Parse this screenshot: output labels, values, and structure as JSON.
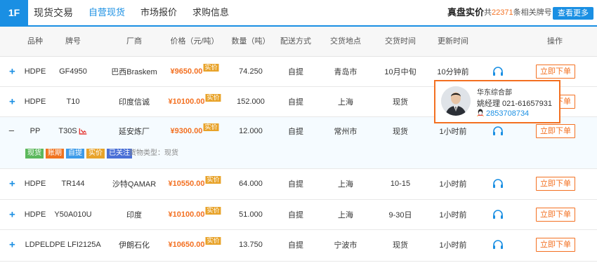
{
  "topbar": {
    "floor": "1F",
    "section": "现货交易",
    "tabs": [
      "自营现货",
      "市场报价",
      "求购信息"
    ],
    "realtime_title": "真盘实价",
    "count_prefix": "共",
    "count": "22371",
    "count_suffix": "条相关牌号",
    "more_label": "查看更多"
  },
  "columns": [
    "品种",
    "牌号",
    "厂商",
    "价格（元/吨）",
    "数量（吨）",
    "配送方式",
    "交货地点",
    "交货时间",
    "更新时间",
    "操作"
  ],
  "rows": [
    {
      "type": "HDPE",
      "grade": "GF4950",
      "maker": "巴西Braskem",
      "price": "¥9650.00",
      "qty": "74.250",
      "delivery": "自提",
      "place": "青岛市",
      "time": "10月中旬",
      "updated": "10分钟前",
      "action": "立即下单"
    },
    {
      "type": "HDPE",
      "grade": "T10",
      "maker": "印度信诚",
      "price": "¥10100.00",
      "qty": "152.000",
      "delivery": "自提",
      "place": "上海",
      "time": "现货",
      "updated": "",
      "action": "立即下单"
    },
    {
      "type": "PP",
      "grade": "T30S",
      "maker": "延安炼厂",
      "price": "¥9300.00",
      "qty": "12.000",
      "delivery": "自提",
      "place": "常州市",
      "time": "现货",
      "updated": "1小时前",
      "action": "立即下单"
    },
    {
      "type": "HDPE",
      "grade": "TR144",
      "maker": "沙特QAMAR",
      "price": "¥10550.00",
      "qty": "64.000",
      "delivery": "自提",
      "place": "上海",
      "time": "10-15",
      "updated": "1小时前",
      "action": "立即下单"
    },
    {
      "type": "HDPE",
      "grade": "Y50A010U",
      "maker": "印度",
      "price": "¥10100.00",
      "qty": "51.000",
      "delivery": "自提",
      "place": "上海",
      "time": "9-30日",
      "updated": "1小时前",
      "action": "立即下单"
    },
    {
      "type": "LDPE",
      "grade": "LDPE LFI2125A",
      "maker": "伊朗石化",
      "price": "¥10650.00",
      "qty": "13.750",
      "delivery": "自提",
      "place": "宁波市",
      "time": "现货",
      "updated": "1小时前",
      "action": "立即下单"
    }
  ],
  "spot_tag": "实价",
  "expand_symbol": "+",
  "collapse_symbol": "−",
  "expanded": {
    "tags": [
      {
        "label": "现货",
        "color": "#5cb85c"
      },
      {
        "label": "账期",
        "color": "#f0731f"
      },
      {
        "label": "自提",
        "color": "#3d9be9"
      },
      {
        "label": "实价",
        "color": "#e8a32a"
      },
      {
        "label": "已关注",
        "color": "#4a6fd6"
      }
    ],
    "goods_type": "货物类型：现货"
  },
  "popup": {
    "company": "华东综合部",
    "contact": "姚经理 021-61657931",
    "qq": "2853708734"
  },
  "colors": {
    "accent": "#1a8fe3",
    "price": "#f37021",
    "highlight_border": "#f37021"
  }
}
